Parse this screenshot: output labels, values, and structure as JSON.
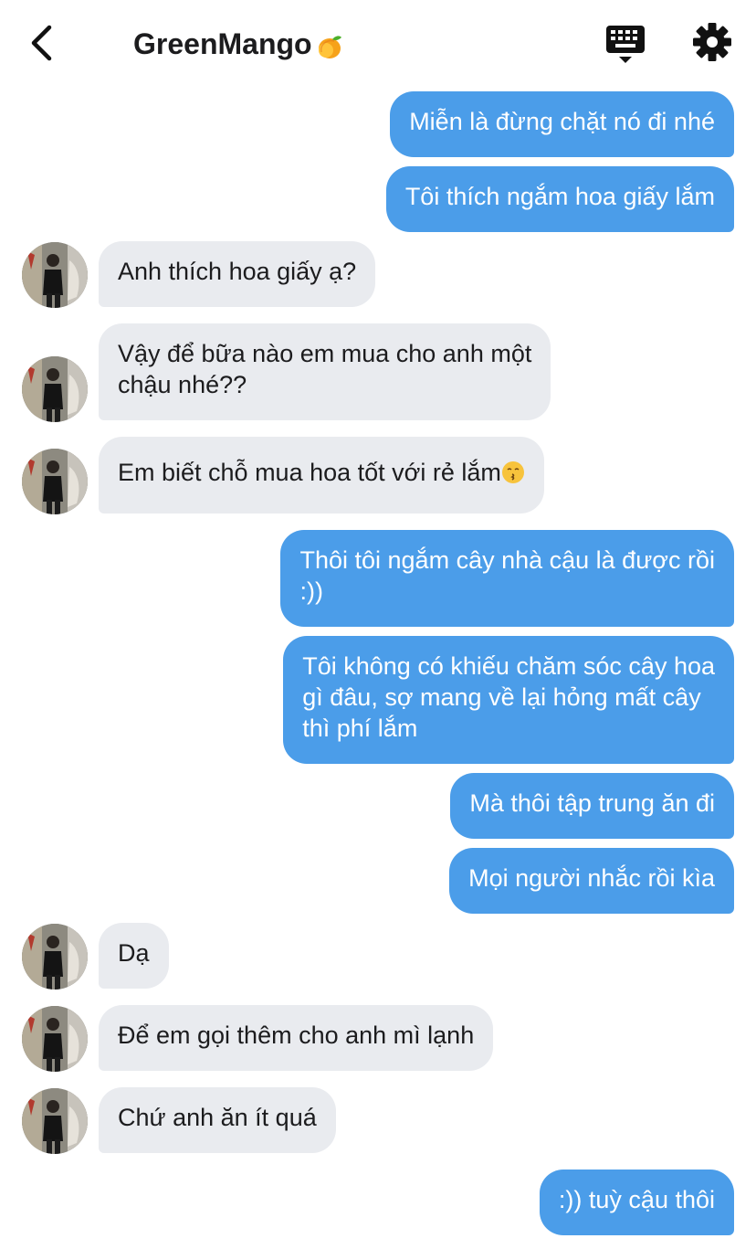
{
  "header": {
    "title": "GreenMango",
    "title_emoji": "mango-emoji",
    "back_icon": "chevron-left-icon",
    "keyboard_icon": "keyboard-icon",
    "settings_icon": "gear-icon"
  },
  "colors": {
    "outgoing_bubble": "#4b9de9",
    "incoming_bubble": "#e9ebef"
  },
  "messages": [
    {
      "side": "out",
      "text": "Miễn là đừng chặt nó đi nhé"
    },
    {
      "side": "out",
      "text": "Tôi thích ngắm hoa giấy lắm"
    },
    {
      "side": "in",
      "text": "Anh thích hoa giấy ạ?"
    },
    {
      "side": "in",
      "text": "Vậy để bữa nào em mua cho anh một\nchậu nhé??"
    },
    {
      "side": "in",
      "text": "Em biết chỗ mua hoa tốt với rẻ lắm",
      "emoji": "kissing-face-emoji"
    },
    {
      "side": "out",
      "text": "Thôi tôi ngắm cây nhà cậu là được rồi\n:))"
    },
    {
      "side": "out",
      "text": "Tôi không có khiếu chăm sóc cây hoa\ngì đâu, sợ mang về lại hỏng mất cây\nthì phí lắm"
    },
    {
      "side": "out",
      "text": "Mà thôi tập trung ăn đi"
    },
    {
      "side": "out",
      "text": "Mọi người nhắc rồi kìa"
    },
    {
      "side": "in",
      "text": "Dạ"
    },
    {
      "side": "in",
      "text": "Để em gọi thêm cho anh mì lạnh"
    },
    {
      "side": "in",
      "text": "Chứ anh ăn ít quá"
    },
    {
      "side": "out",
      "text": ":)) tuỳ cậu thôi"
    }
  ]
}
